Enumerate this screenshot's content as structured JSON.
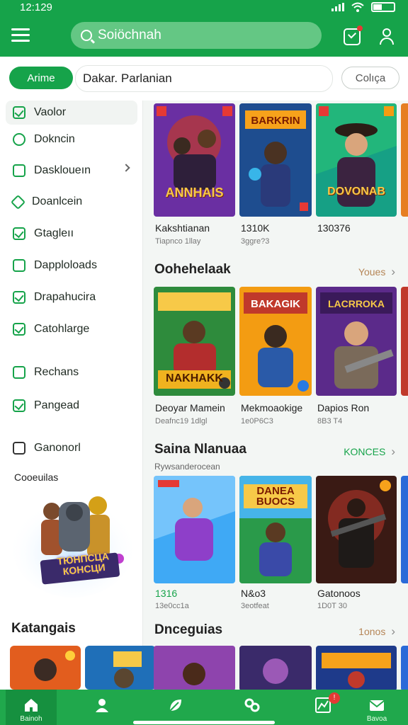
{
  "status_bar": {
    "time": "12:129"
  },
  "header": {
    "search_placeholder": "Soiöchnah"
  },
  "filter": {
    "active_pill": "Arime",
    "field_value": "Dakar. Parlanian",
    "right_pill": "Colıça"
  },
  "sidebar": {
    "items": [
      {
        "label": "Vaolor",
        "icon": "bookmark-icon"
      },
      {
        "label": "Dokncin",
        "icon": "puzzle-icon"
      },
      {
        "label": "Daskloueın",
        "icon": "controller-icon"
      },
      {
        "label": "Doanlcein",
        "icon": "leaf-icon"
      },
      {
        "label": "Gtagleıı",
        "icon": "check-square-icon"
      },
      {
        "label": "Dapploloads",
        "icon": "download-icon"
      },
      {
        "label": "Drapahucira",
        "icon": "mail-icon"
      },
      {
        "label": "Catohlarge",
        "icon": "chart-icon"
      },
      {
        "label": "Rechans",
        "icon": "square-icon"
      },
      {
        "label": "Pangead",
        "icon": "check-icon"
      },
      {
        "label": "Ganonorl",
        "icon": "list-icon"
      }
    ],
    "promo_title": "Cooeuilas",
    "promo_art_text": "ТЮНПСЦА КОНСЦИ",
    "category_title": "Katangais"
  },
  "sections": [
    {
      "title": "",
      "more": "",
      "cards": [
        {
          "title": "Kakshtianan",
          "sub": "Tiapnco    1llay",
          "art_text": "ANNHAIS"
        },
        {
          "title": "1310K",
          "sub": "3ggre?3",
          "art_text": "BARKRIN"
        },
        {
          "title": "130376",
          "sub": "",
          "art_text": "DOVONAB"
        }
      ]
    },
    {
      "title": "Oohehelaak",
      "more": "Youes",
      "cards": [
        {
          "title": "Deoyar Mamein",
          "sub": "Deafnc19    1dlgl",
          "art_text": "NAKHAKK"
        },
        {
          "title": "Mekmoaokige",
          "sub": "1e0P6C3",
          "art_text": "BAKAGIK"
        },
        {
          "title": "Dapios Ron",
          "sub": "8B3 T4",
          "art_text": "LACRROKA"
        }
      ]
    },
    {
      "title": "Saina Nlanuaa",
      "more": "KONCES",
      "sub": "Rywsanderocean",
      "cards": [
        {
          "title": "1316",
          "sub": "13e0cc1a",
          "art_text": ""
        },
        {
          "title": "N&o3",
          "sub": "3eotfeat",
          "art_text": "DANEA BUOCS"
        },
        {
          "title": "Gatonoos",
          "sub": "1D0T 30",
          "art_text": ""
        }
      ]
    },
    {
      "title": "Dnceguias",
      "more": "1onos",
      "cards": []
    }
  ],
  "bottom_nav": [
    {
      "label": "Bainoh",
      "icon": "home-icon",
      "active": true
    },
    {
      "label": "",
      "icon": "person-icon"
    },
    {
      "label": "",
      "icon": "leaf-icon"
    },
    {
      "label": "",
      "icon": "link-icon"
    },
    {
      "label": "",
      "icon": "chart-icon",
      "badge": "!"
    },
    {
      "label": "Bavoa",
      "icon": "mail-icon"
    }
  ],
  "colors": {
    "brand": "#16a34a",
    "accent_more": "#b58556"
  }
}
